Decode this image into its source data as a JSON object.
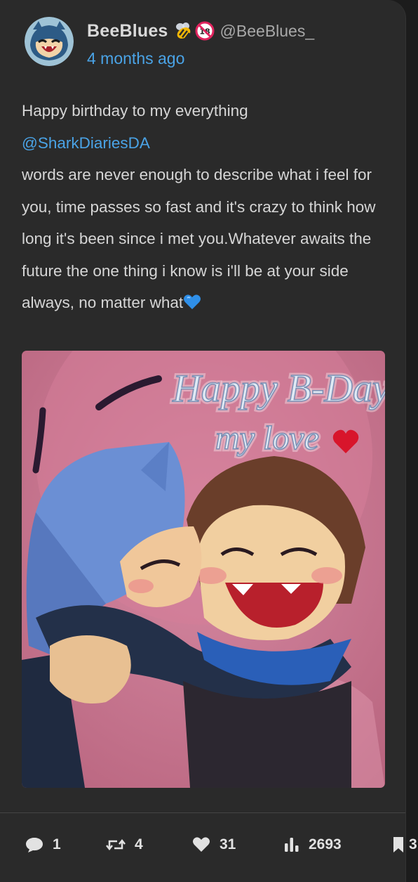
{
  "post": {
    "author": {
      "display_name": "BeeBlues",
      "handle": "@BeeBlues_",
      "badges": [
        "bee-emoji",
        "no-under-18-emoji"
      ]
    },
    "timestamp": "4 months ago",
    "text": {
      "line1": "Happy birthday to my everything",
      "mention": "@SharkDiariesDA",
      "body": "words are never enough to describe what i feel for you, time passes so fast and it's crazy to think how long it's been since i met you.Whatever awaits the future the one thing i know is i'll be at your side always, no matter what",
      "trailing_emoji": "blue-heart-emoji"
    },
    "image": {
      "lettering_line1": "Happy B-Day",
      "lettering_line2": "my love",
      "lettering_color": "#dfe9f4"
    }
  },
  "actions": {
    "replies": {
      "icon": "comment-icon",
      "count": "1"
    },
    "reposts": {
      "icon": "repost-icon",
      "count": "4"
    },
    "likes": {
      "icon": "heart-icon",
      "count": "31"
    },
    "views": {
      "icon": "views-bars-icon",
      "count": "2693"
    },
    "bookmark": {
      "icon": "bookmark-icon",
      "count": "3"
    }
  },
  "colors": {
    "background": "#2a2a2a",
    "text": "#d6d6d6",
    "accent": "#4aa3e6",
    "artwork_background": "#c7728f"
  }
}
